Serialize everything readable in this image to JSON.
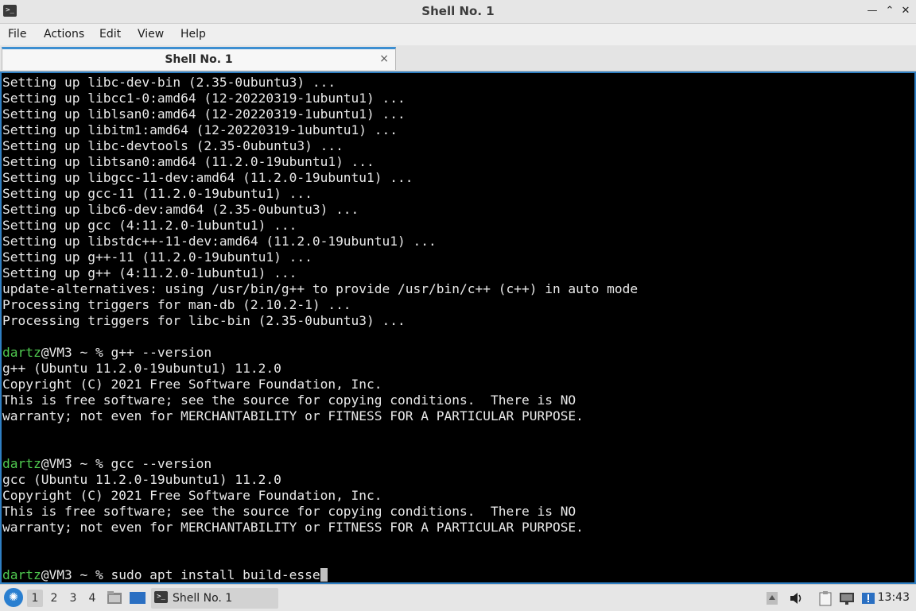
{
  "window": {
    "title": "Shell No. 1",
    "controls": {
      "minimize": "—",
      "restore": "⌃",
      "maximize": "⬦",
      "close": "✕"
    }
  },
  "menu": {
    "items": [
      "File",
      "Actions",
      "Edit",
      "View",
      "Help"
    ]
  },
  "tabs": [
    {
      "label": "Shell No. 1",
      "close": "×"
    }
  ],
  "terminal": {
    "lines": [
      {
        "text": "Setting up libc-dev-bin (2.35-0ubuntu3) ..."
      },
      {
        "text": "Setting up libcc1-0:amd64 (12-20220319-1ubuntu1) ..."
      },
      {
        "text": "Setting up liblsan0:amd64 (12-20220319-1ubuntu1) ..."
      },
      {
        "text": "Setting up libitm1:amd64 (12-20220319-1ubuntu1) ..."
      },
      {
        "text": "Setting up libc-devtools (2.35-0ubuntu3) ..."
      },
      {
        "text": "Setting up libtsan0:amd64 (11.2.0-19ubuntu1) ..."
      },
      {
        "text": "Setting up libgcc-11-dev:amd64 (11.2.0-19ubuntu1) ..."
      },
      {
        "text": "Setting up gcc-11 (11.2.0-19ubuntu1) ..."
      },
      {
        "text": "Setting up libc6-dev:amd64 (2.35-0ubuntu3) ..."
      },
      {
        "text": "Setting up gcc (4:11.2.0-1ubuntu1) ..."
      },
      {
        "text": "Setting up libstdc++-11-dev:amd64 (11.2.0-19ubuntu1) ..."
      },
      {
        "text": "Setting up g++-11 (11.2.0-19ubuntu1) ..."
      },
      {
        "text": "Setting up g++ (4:11.2.0-1ubuntu1) ..."
      },
      {
        "text": "update-alternatives: using /usr/bin/g++ to provide /usr/bin/c++ (c++) in auto mode"
      },
      {
        "text": "Processing triggers for man-db (2.10.2-1) ..."
      },
      {
        "text": "Processing triggers for libc-bin (2.35-0ubuntu3) ..."
      },
      {
        "text": ""
      },
      {
        "prompt_user": "dartz",
        "prompt_rest": "@VM3 ~ % ",
        "command": "g++ --version"
      },
      {
        "text": "g++ (Ubuntu 11.2.0-19ubuntu1) 11.2.0"
      },
      {
        "text": "Copyright (C) 2021 Free Software Foundation, Inc."
      },
      {
        "text": "This is free software; see the source for copying conditions.  There is NO"
      },
      {
        "text": "warranty; not even for MERCHANTABILITY or FITNESS FOR A PARTICULAR PURPOSE."
      },
      {
        "text": ""
      },
      {
        "text": ""
      },
      {
        "prompt_user": "dartz",
        "prompt_rest": "@VM3 ~ % ",
        "command": "gcc --version"
      },
      {
        "text": "gcc (Ubuntu 11.2.0-19ubuntu1) 11.2.0"
      },
      {
        "text": "Copyright (C) 2021 Free Software Foundation, Inc."
      },
      {
        "text": "This is free software; see the source for copying conditions.  There is NO"
      },
      {
        "text": "warranty; not even for MERCHANTABILITY or FITNESS FOR A PARTICULAR PURPOSE."
      },
      {
        "text": ""
      },
      {
        "text": ""
      },
      {
        "prompt_user": "dartz",
        "prompt_rest": "@VM3 ~ % ",
        "command": "sudo apt install build-esse",
        "cursor": true
      }
    ],
    "colors": {
      "prompt_user": "#4fc84f",
      "text": "#e8e8e8",
      "border": "#2f7fc3"
    }
  },
  "taskbar": {
    "workspaces": [
      "1",
      "2",
      "3",
      "4"
    ],
    "active_workspace": "1",
    "task": {
      "label": "Shell No. 1"
    },
    "clock": "13:43"
  }
}
